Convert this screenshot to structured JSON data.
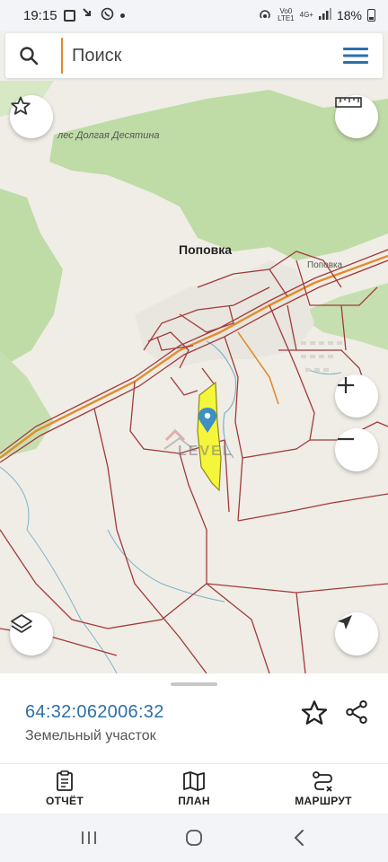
{
  "status_bar": {
    "time": "19:15",
    "network_label_top": "Vo0",
    "network_label_bottom": "LTE1",
    "signal_label": "4G+",
    "battery": "18%"
  },
  "search": {
    "placeholder": "Поиск",
    "icon": "search-icon",
    "menu_icon": "hamburger-menu-icon"
  },
  "map": {
    "labels": {
      "forest": "лес Долгая Десятина",
      "village": "Поповка",
      "village_small": "Поповка"
    },
    "watermark": "LEVEL",
    "colors": {
      "forest": "#bcd9a2",
      "parcel_lines": "#a23a3a",
      "road": "#e08a2c",
      "selected_parcel": "#f5f53a",
      "marker": "#3d8fc4"
    },
    "controls": {
      "favorites_icon": "star-icon",
      "ruler_icon": "ruler-icon",
      "zoom_in_icon": "plus-icon",
      "zoom_out_icon": "minus-icon",
      "layers_icon": "layers-icon",
      "location_icon": "navigation-arrow-icon"
    }
  },
  "sheet": {
    "cadastral_number": "64:32:062006:32",
    "object_type": "Земельный участок"
  },
  "bottom_nav": [
    {
      "label": "ОТЧЁТ",
      "icon": "report-clipboard-icon"
    },
    {
      "label": "ПЛАН",
      "icon": "map-plan-icon"
    },
    {
      "label": "МАРШРУТ",
      "icon": "route-icon"
    }
  ]
}
